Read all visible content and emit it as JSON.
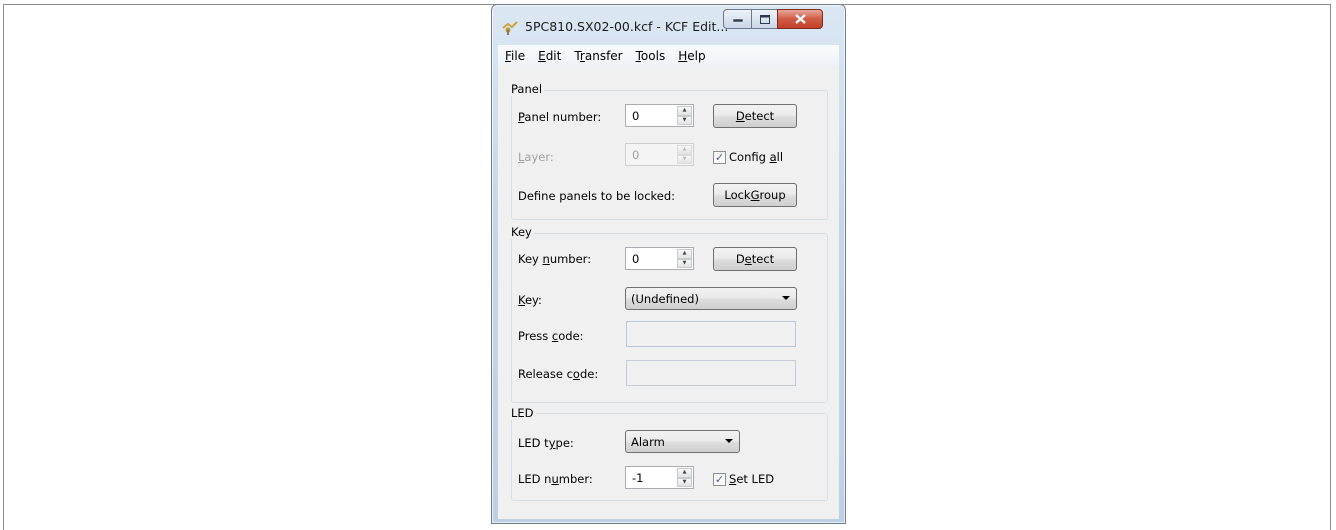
{
  "window": {
    "title": "5PC810.SX02-00.kcf - KCF Edit...",
    "accent_close": "#c7452f"
  },
  "menu": {
    "items": [
      {
        "label_pre": "",
        "mnemonic": "F",
        "label_post": "ile"
      },
      {
        "label_pre": "",
        "mnemonic": "E",
        "label_post": "dit"
      },
      {
        "label_pre": "T",
        "mnemonic": "r",
        "label_post": "ansfer"
      },
      {
        "label_pre": "",
        "mnemonic": "T",
        "label_post": "ools"
      },
      {
        "label_pre": "",
        "mnemonic": "H",
        "label_post": "elp"
      }
    ]
  },
  "panel": {
    "title": "Panel",
    "panel_number_label": {
      "pre": "",
      "mn": "P",
      "post": "anel number:"
    },
    "panel_number_value": "0",
    "detect_label": {
      "pre": "",
      "mn": "D",
      "post": "etect"
    },
    "layer_label": {
      "pre": "",
      "mn": "L",
      "post": "ayer:"
    },
    "layer_value": "0",
    "config_all_label": {
      "pre": "Config ",
      "mn": "a",
      "post": "ll"
    },
    "config_all_checked": true,
    "lock_text": "Define panels to be locked:",
    "lock_group_label": {
      "pre": "Lock ",
      "mn": "G",
      "post": "roup"
    }
  },
  "key": {
    "title": "Key",
    "key_number_label": {
      "pre": "Key ",
      "mn": "n",
      "post": "umber:"
    },
    "key_number_value": "0",
    "detect_label": {
      "pre": "D",
      "mn": "e",
      "post": "tect"
    },
    "key_label": {
      "pre": "",
      "mn": "K",
      "post": "ey:"
    },
    "key_value": "(Undefined)",
    "press_code_label": {
      "pre": "Press ",
      "mn": "c",
      "post": "ode:"
    },
    "press_code_value": "",
    "release_code_label": {
      "pre": "Release c",
      "mn": "o",
      "post": "de:"
    },
    "release_code_value": ""
  },
  "led": {
    "title": "LED",
    "led_type_label": {
      "pre": "LED t",
      "mn": "y",
      "post": "pe:"
    },
    "led_type_value": "Alarm",
    "led_number_label": {
      "pre": "LED n",
      "mn": "u",
      "post": "mber:"
    },
    "led_number_value": "-1",
    "set_led_label": {
      "pre": "",
      "mn": "S",
      "post": "et LED"
    },
    "set_led_checked": true
  }
}
